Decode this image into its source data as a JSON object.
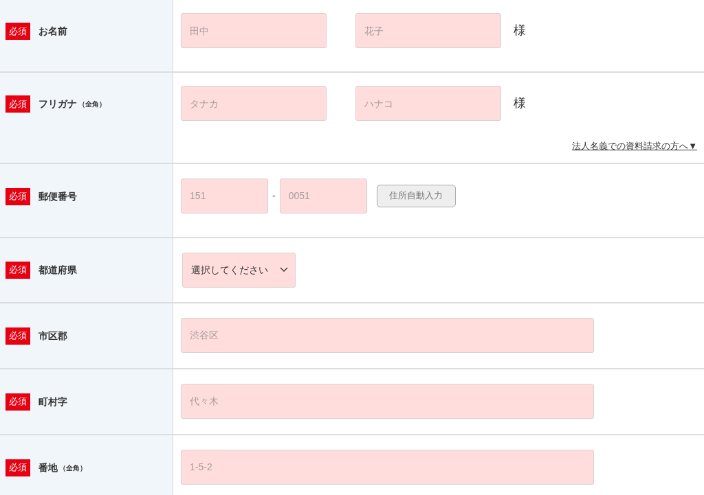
{
  "rows": [
    {
      "kind": "name",
      "badge": "必須",
      "label": "お名前",
      "fields": [
        {
          "placeholder": "田中"
        },
        {
          "placeholder": "花子"
        }
      ],
      "suffix": "様"
    },
    {
      "kind": "name",
      "badge": "必須",
      "label": "フリガナ",
      "note": "（全角）",
      "fields": [
        {
          "placeholder": "タナカ"
        },
        {
          "placeholder": "ハナコ"
        }
      ],
      "suffix": "様",
      "link": "法人名義での資料請求の方へ▼"
    },
    {
      "kind": "postal",
      "badge": "必須",
      "label": "郵便番号",
      "fields": [
        {
          "placeholder": "151"
        },
        {
          "placeholder": "0051"
        }
      ],
      "separator": "-",
      "button": "住所自動入力"
    },
    {
      "kind": "select",
      "badge": "必須",
      "label": "都道府県",
      "select": "選択してください"
    },
    {
      "kind": "text",
      "badge": "必須",
      "label": "市区郡",
      "fields": [
        {
          "placeholder": "渋谷区"
        }
      ]
    },
    {
      "kind": "text",
      "badge": "必須",
      "label": "町村字",
      "fields": [
        {
          "placeholder": "代々木"
        }
      ]
    },
    {
      "kind": "text",
      "badge": "必須",
      "label": "番地",
      "note": "（全角）",
      "fields": [
        {
          "placeholder": "1-5-2"
        }
      ]
    }
  ]
}
